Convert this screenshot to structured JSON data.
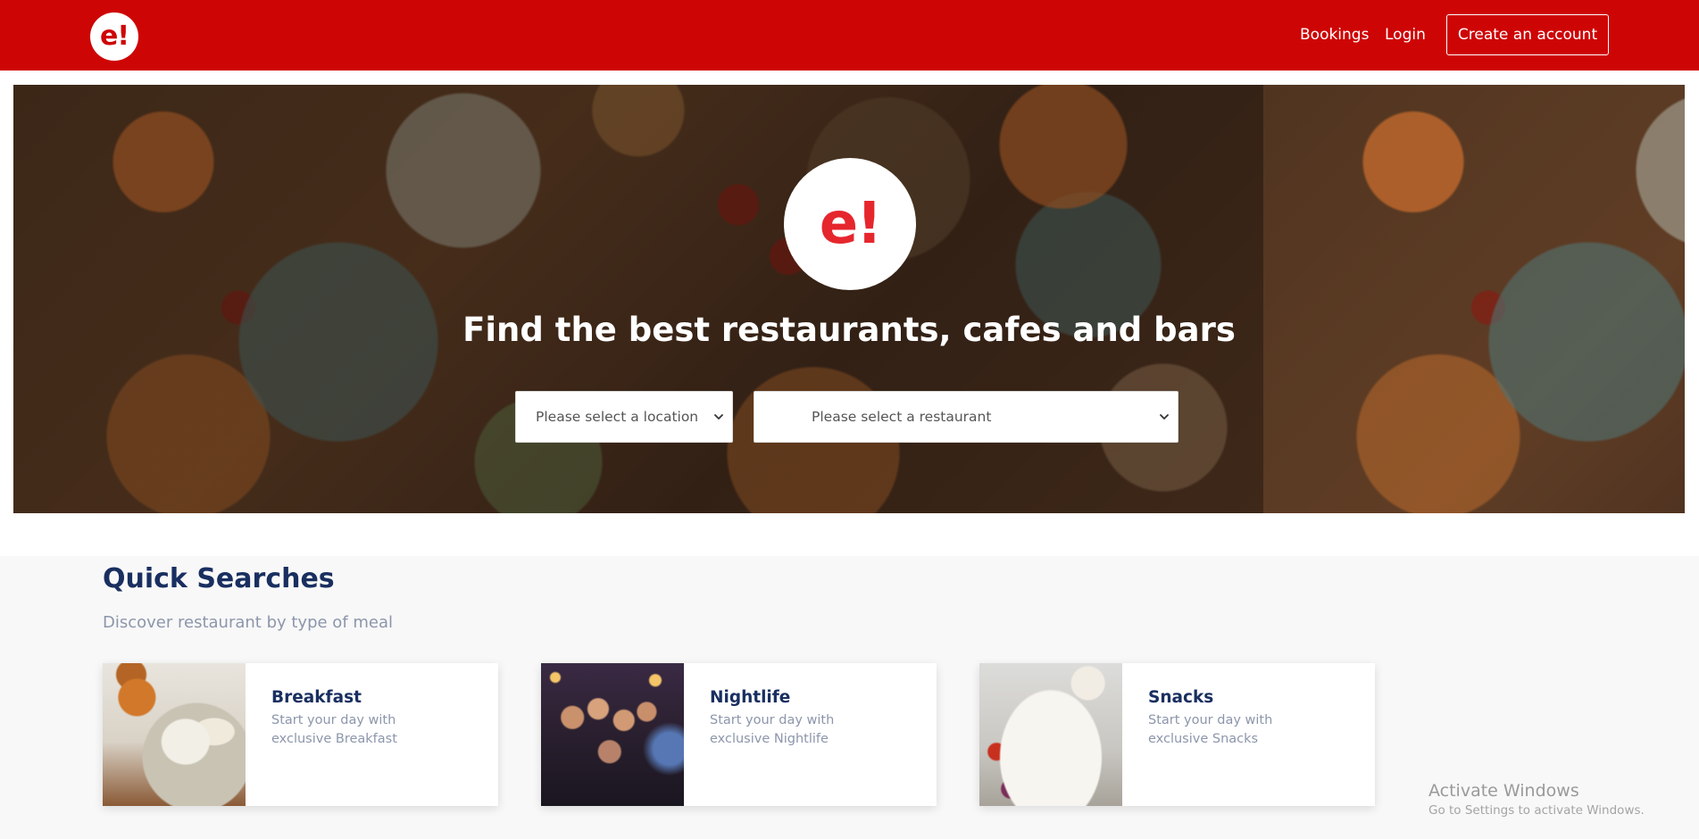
{
  "colors": {
    "brand_red": "#ce0505",
    "logo_red": "#e6262d",
    "heading_navy": "#192f60",
    "muted_text": "#8c96ab",
    "section_background": "#f8f8f8"
  },
  "header": {
    "logo_text": "e!",
    "nav": {
      "bookings": "Bookings",
      "login": "Login",
      "create_account": "Create an account"
    }
  },
  "hero": {
    "logo_text": "e!",
    "title": "Find the best restaurants, cafes and bars",
    "location_select": {
      "selected": "Please select a location",
      "icon": "chevron-down-icon"
    },
    "restaurant_select": {
      "selected": "Please select a restaurant",
      "icon": "chevron-down-icon"
    }
  },
  "quick_searches": {
    "title": "Quick Searches",
    "subtitle": "Discover restaurant by type of meal",
    "cards": [
      {
        "name": "Breakfast",
        "description": "Start your day with exclusive Breakfast"
      },
      {
        "name": "Nightlife",
        "description": "Start your day with exclusive Nightlife"
      },
      {
        "name": "Snacks",
        "description": "Start your day with exclusive Snacks"
      }
    ]
  },
  "watermark": {
    "title": "Activate Windows",
    "subtitle": "Go to Settings to activate Windows."
  }
}
